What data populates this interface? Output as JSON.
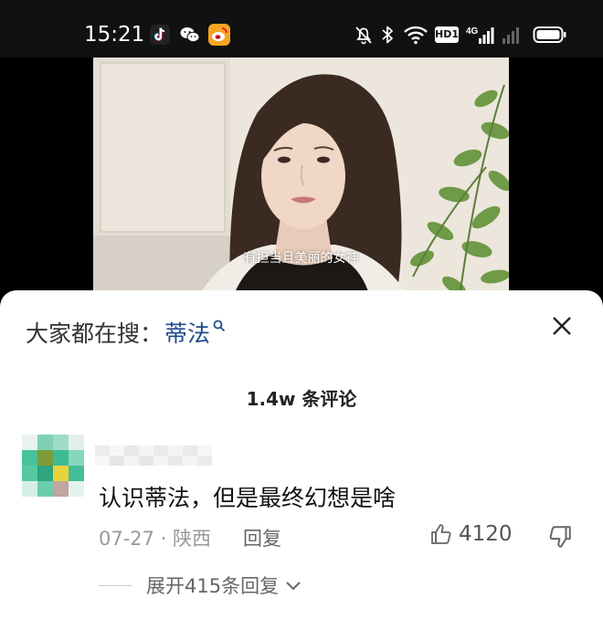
{
  "status_bar": {
    "time": "15:21",
    "app_icons": [
      "tiktok-icon",
      "wechat-icon",
      "weibo-icon"
    ],
    "system_icons": [
      "mute-bell-icon",
      "bluetooth-icon",
      "wifi-icon",
      "hd-icon",
      "signal-4g-icon",
      "signal-icon",
      "battery-icon"
    ],
    "network_label": "4G",
    "hd_label": "HD1"
  },
  "video": {
    "subtitle": "有担当且美丽的女神"
  },
  "search": {
    "prefix": "大家都在搜：",
    "term": "蒂法"
  },
  "comments": {
    "count_label": "1.4w 条评论",
    "items": [
      {
        "text": "认识蒂法，但是最终幻想是啥",
        "meta": "07-27 · 陕西",
        "reply_label": "回复",
        "likes": "4120",
        "expand_label": "展开415条回复"
      }
    ]
  },
  "colors": {
    "accent": "#1f4d8c",
    "status_bar_bg": "#111111",
    "weibo": "#f5a623",
    "muted": "#999999"
  }
}
